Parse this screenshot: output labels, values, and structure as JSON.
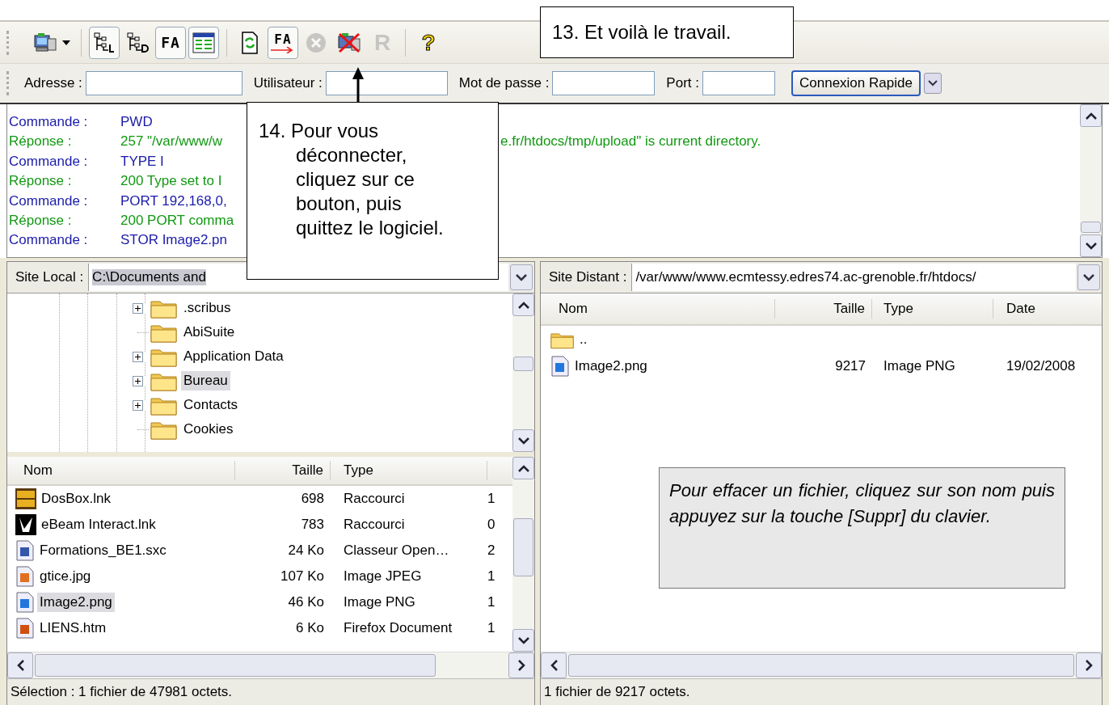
{
  "toolbar": {
    "buttons": [
      {
        "kind": "site-manager",
        "on": false,
        "disabled": false
      },
      {
        "kind": "tree-local",
        "on": true,
        "disabled": false
      },
      {
        "kind": "tree-remote",
        "on": false,
        "disabled": false
      },
      {
        "kind": "log",
        "label": "FA",
        "on": true,
        "disabled": false
      },
      {
        "kind": "queue",
        "on": true,
        "disabled": false
      },
      {
        "kind": "refresh",
        "on": false,
        "disabled": false
      },
      {
        "kind": "transfer",
        "label": "FA",
        "on": true,
        "disabled": false
      },
      {
        "kind": "cancel",
        "on": false,
        "disabled": true
      },
      {
        "kind": "disconnect",
        "on": false,
        "disabled": false
      },
      {
        "kind": "reconnect",
        "label": "R",
        "on": false,
        "disabled": true
      },
      {
        "kind": "help",
        "label": "?",
        "on": false,
        "disabled": false
      }
    ]
  },
  "quickconnect": {
    "fields": [
      {
        "label": "Adresse :"
      },
      {
        "label": "Utilisateur :"
      },
      {
        "label": "Mot de passe :"
      },
      {
        "label": "Port :"
      }
    ],
    "button": "Connexion Rapide"
  },
  "log": [
    {
      "kind": "command",
      "label": "Commande :",
      "text": "PWD"
    },
    {
      "kind": "response",
      "label": "Réponse :",
      "text": "257 \"/var/www/w",
      "text_after": "e.fr/htdocs/tmp/upload\" is current directory."
    },
    {
      "kind": "command",
      "label": "Commande :",
      "text": "TYPE I"
    },
    {
      "kind": "response",
      "label": "Réponse :",
      "text": "200 Type set to I"
    },
    {
      "kind": "command",
      "label": "Commande :",
      "text": "PORT 192,168,0,"
    },
    {
      "kind": "response",
      "label": "Réponse :",
      "text": "200 PORT comma"
    },
    {
      "kind": "command",
      "label": "Commande :",
      "text": "STOR Image2.pn"
    }
  ],
  "local": {
    "site_label": "Site Local :",
    "path": "C:\\Documents and",
    "tree": [
      {
        "name": ".scribus",
        "expandable": true,
        "selected": false
      },
      {
        "name": "AbiSuite",
        "expandable": false,
        "selected": false
      },
      {
        "name": "Application Data",
        "expandable": true,
        "selected": false
      },
      {
        "name": "Bureau",
        "expandable": true,
        "selected": true
      },
      {
        "name": "Contacts",
        "expandable": true,
        "selected": false
      },
      {
        "name": "Cookies",
        "expandable": false,
        "selected": false
      }
    ],
    "columns": [
      "Nom",
      "Taille",
      "Type"
    ],
    "rows": [
      {
        "kind": "dosbox",
        "name": "DosBox.lnk",
        "size": "698",
        "type": "Raccourci",
        "column_4": "1",
        "selected": false
      },
      {
        "kind": "ebeam",
        "name": "eBeam Interact.lnk",
        "size": "783",
        "type": "Raccourci",
        "column_4": "0",
        "selected": false
      },
      {
        "kind": "sheet",
        "name": "Formations_BE1.sxc",
        "size": "24 Ko",
        "type": "Classeur Open…",
        "column_4": "2",
        "selected": false
      },
      {
        "kind": "jpeg",
        "name": "gtice.jpg",
        "size": "107 Ko",
        "type": "Image JPEG",
        "column_4": "1",
        "selected": false
      },
      {
        "kind": "png",
        "name": "Image2.png",
        "size": "46 Ko",
        "type": "Image PNG",
        "column_4": "1",
        "selected": true
      },
      {
        "kind": "html",
        "name": "LIENS.htm",
        "size": "6 Ko",
        "type": "Firefox Document",
        "column_4": "1",
        "selected": false
      }
    ],
    "status": "Sélection : 1 fichier de 47981 octets."
  },
  "remote": {
    "site_label": "Site Distant :",
    "path": "/var/www/www.ecmtessy.edres74.ac-grenoble.fr/htdocs/",
    "columns": [
      "Nom",
      "Taille",
      "Type",
      "Date"
    ],
    "rows": [
      {
        "kind": "folder",
        "name": ".."
      },
      {
        "kind": "png",
        "name": "Image2.png",
        "size": "9217",
        "type": "Image PNG",
        "date": "19/02/2008"
      }
    ],
    "status": "1 fichier de 9217 octets."
  },
  "callouts": [
    {
      "kind": "step-top",
      "text": "13. Et voilà le travail."
    },
    {
      "kind": "step-arrow",
      "text": "14. Pour vous déconnecter, cliquez sur ce bouton, puis quittez le logiciel."
    },
    {
      "kind": "note",
      "text": "Pour effacer un fichier, cliquez sur son nom puis appuyez sur la touche [Suppr] du clavier."
    }
  ]
}
